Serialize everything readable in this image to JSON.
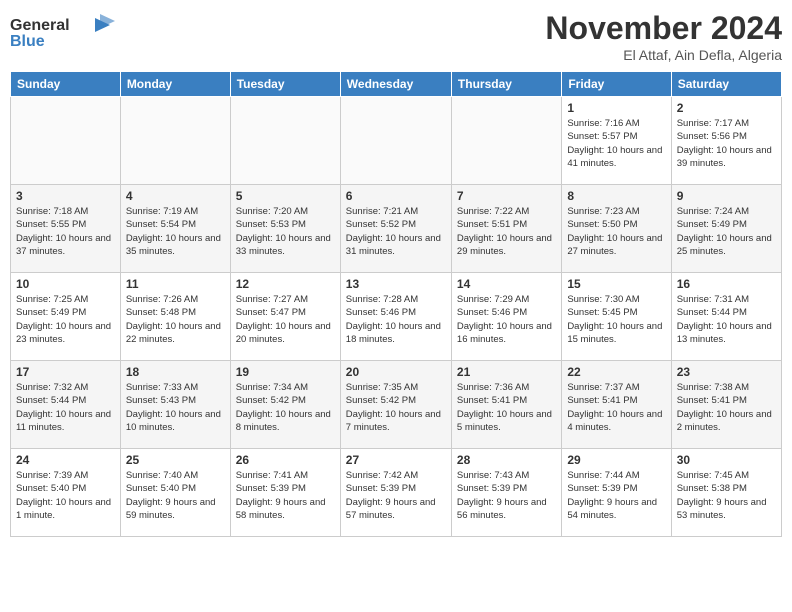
{
  "header": {
    "logo_line1": "General",
    "logo_line2": "Blue",
    "month": "November 2024",
    "location": "El Attaf, Ain Defla, Algeria"
  },
  "days_of_week": [
    "Sunday",
    "Monday",
    "Tuesday",
    "Wednesday",
    "Thursday",
    "Friday",
    "Saturday"
  ],
  "weeks": [
    [
      {
        "day": "",
        "info": ""
      },
      {
        "day": "",
        "info": ""
      },
      {
        "day": "",
        "info": ""
      },
      {
        "day": "",
        "info": ""
      },
      {
        "day": "",
        "info": ""
      },
      {
        "day": "1",
        "info": "Sunrise: 7:16 AM\nSunset: 5:57 PM\nDaylight: 10 hours and 41 minutes."
      },
      {
        "day": "2",
        "info": "Sunrise: 7:17 AM\nSunset: 5:56 PM\nDaylight: 10 hours and 39 minutes."
      }
    ],
    [
      {
        "day": "3",
        "info": "Sunrise: 7:18 AM\nSunset: 5:55 PM\nDaylight: 10 hours and 37 minutes."
      },
      {
        "day": "4",
        "info": "Sunrise: 7:19 AM\nSunset: 5:54 PM\nDaylight: 10 hours and 35 minutes."
      },
      {
        "day": "5",
        "info": "Sunrise: 7:20 AM\nSunset: 5:53 PM\nDaylight: 10 hours and 33 minutes."
      },
      {
        "day": "6",
        "info": "Sunrise: 7:21 AM\nSunset: 5:52 PM\nDaylight: 10 hours and 31 minutes."
      },
      {
        "day": "7",
        "info": "Sunrise: 7:22 AM\nSunset: 5:51 PM\nDaylight: 10 hours and 29 minutes."
      },
      {
        "day": "8",
        "info": "Sunrise: 7:23 AM\nSunset: 5:50 PM\nDaylight: 10 hours and 27 minutes."
      },
      {
        "day": "9",
        "info": "Sunrise: 7:24 AM\nSunset: 5:49 PM\nDaylight: 10 hours and 25 minutes."
      }
    ],
    [
      {
        "day": "10",
        "info": "Sunrise: 7:25 AM\nSunset: 5:49 PM\nDaylight: 10 hours and 23 minutes."
      },
      {
        "day": "11",
        "info": "Sunrise: 7:26 AM\nSunset: 5:48 PM\nDaylight: 10 hours and 22 minutes."
      },
      {
        "day": "12",
        "info": "Sunrise: 7:27 AM\nSunset: 5:47 PM\nDaylight: 10 hours and 20 minutes."
      },
      {
        "day": "13",
        "info": "Sunrise: 7:28 AM\nSunset: 5:46 PM\nDaylight: 10 hours and 18 minutes."
      },
      {
        "day": "14",
        "info": "Sunrise: 7:29 AM\nSunset: 5:46 PM\nDaylight: 10 hours and 16 minutes."
      },
      {
        "day": "15",
        "info": "Sunrise: 7:30 AM\nSunset: 5:45 PM\nDaylight: 10 hours and 15 minutes."
      },
      {
        "day": "16",
        "info": "Sunrise: 7:31 AM\nSunset: 5:44 PM\nDaylight: 10 hours and 13 minutes."
      }
    ],
    [
      {
        "day": "17",
        "info": "Sunrise: 7:32 AM\nSunset: 5:44 PM\nDaylight: 10 hours and 11 minutes."
      },
      {
        "day": "18",
        "info": "Sunrise: 7:33 AM\nSunset: 5:43 PM\nDaylight: 10 hours and 10 minutes."
      },
      {
        "day": "19",
        "info": "Sunrise: 7:34 AM\nSunset: 5:42 PM\nDaylight: 10 hours and 8 minutes."
      },
      {
        "day": "20",
        "info": "Sunrise: 7:35 AM\nSunset: 5:42 PM\nDaylight: 10 hours and 7 minutes."
      },
      {
        "day": "21",
        "info": "Sunrise: 7:36 AM\nSunset: 5:41 PM\nDaylight: 10 hours and 5 minutes."
      },
      {
        "day": "22",
        "info": "Sunrise: 7:37 AM\nSunset: 5:41 PM\nDaylight: 10 hours and 4 minutes."
      },
      {
        "day": "23",
        "info": "Sunrise: 7:38 AM\nSunset: 5:41 PM\nDaylight: 10 hours and 2 minutes."
      }
    ],
    [
      {
        "day": "24",
        "info": "Sunrise: 7:39 AM\nSunset: 5:40 PM\nDaylight: 10 hours and 1 minute."
      },
      {
        "day": "25",
        "info": "Sunrise: 7:40 AM\nSunset: 5:40 PM\nDaylight: 9 hours and 59 minutes."
      },
      {
        "day": "26",
        "info": "Sunrise: 7:41 AM\nSunset: 5:39 PM\nDaylight: 9 hours and 58 minutes."
      },
      {
        "day": "27",
        "info": "Sunrise: 7:42 AM\nSunset: 5:39 PM\nDaylight: 9 hours and 57 minutes."
      },
      {
        "day": "28",
        "info": "Sunrise: 7:43 AM\nSunset: 5:39 PM\nDaylight: 9 hours and 56 minutes."
      },
      {
        "day": "29",
        "info": "Sunrise: 7:44 AM\nSunset: 5:39 PM\nDaylight: 9 hours and 54 minutes."
      },
      {
        "day": "30",
        "info": "Sunrise: 7:45 AM\nSunset: 5:38 PM\nDaylight: 9 hours and 53 minutes."
      }
    ]
  ]
}
